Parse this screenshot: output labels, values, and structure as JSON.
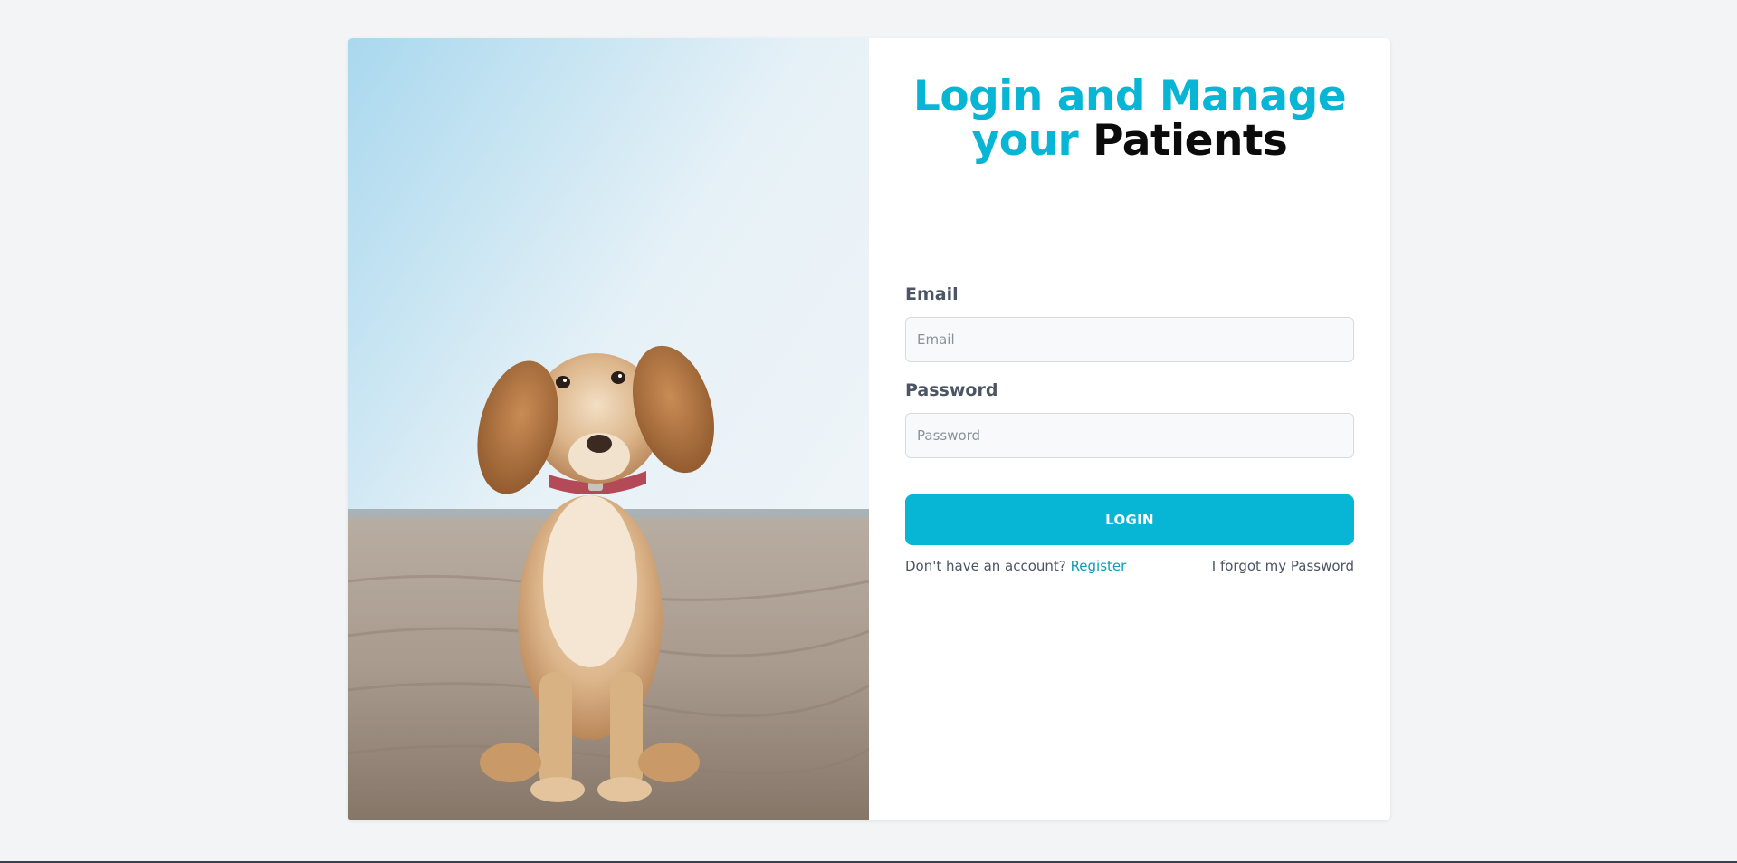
{
  "headline": {
    "line1": "Login and Manage",
    "line2_accent": "your",
    "line2_dark": "Patients"
  },
  "form": {
    "email_label": "Email",
    "email_placeholder": "Email",
    "password_label": "Password",
    "password_placeholder": "Password",
    "login_label": "LOGIN"
  },
  "footer": {
    "no_account_text": "Don't have an account?",
    "register_label": "Register",
    "forgot_label": "I forgot my Password"
  },
  "colors": {
    "accent": "#06b6d4",
    "page_background": "#f3f4f6",
    "headline_dark": "#0b0b0b"
  },
  "image": {
    "subject": "puppy sitting on beach sand"
  }
}
